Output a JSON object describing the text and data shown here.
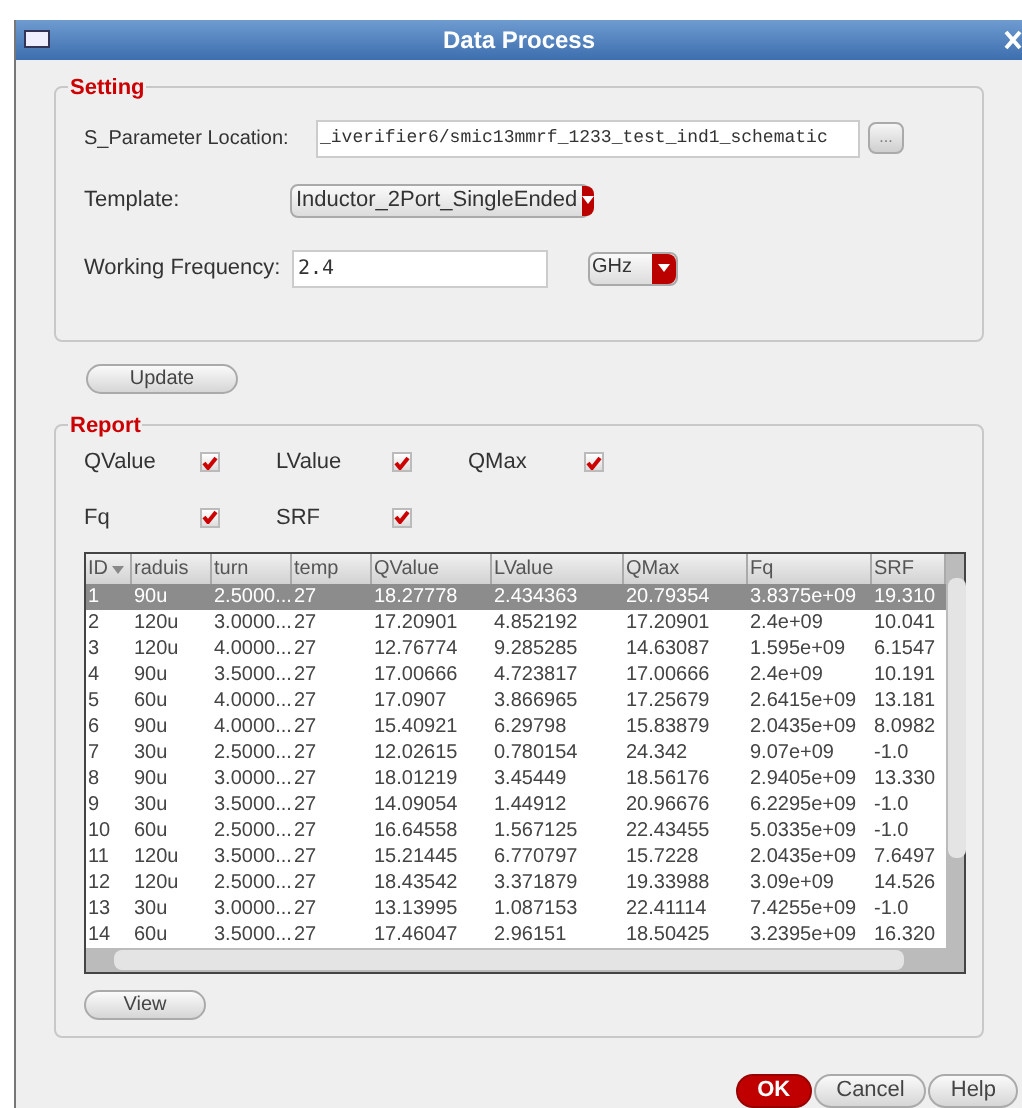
{
  "window": {
    "title": "Data Process"
  },
  "setting": {
    "title": "Setting",
    "location": {
      "label": "S_Parameter Location:",
      "value": "_iverifier6/smic13mmrf_1233_test_ind1_schematic",
      "browse": "..."
    },
    "template": {
      "label": "Template:",
      "value": "Inductor_2Port_SingleEnded"
    },
    "frequency": {
      "label": "Working Frequency:",
      "value": "2.4",
      "unit": "GHz"
    }
  },
  "update_button": "Update",
  "report": {
    "title": "Report",
    "options": [
      {
        "label": "QValue",
        "checked": true
      },
      {
        "label": "LValue",
        "checked": true
      },
      {
        "label": "QMax",
        "checked": true
      },
      {
        "label": "Fq",
        "checked": true
      },
      {
        "label": "SRF",
        "checked": true
      }
    ],
    "table": {
      "columns": [
        "ID",
        "raduis",
        "turn",
        "temp",
        "QValue",
        "LValue",
        "QMax",
        "Fq",
        "SRF"
      ],
      "rows": [
        {
          "selected": true,
          "cells": [
            "1",
            "90u",
            "2.5000...",
            "27",
            "18.27778",
            "2.434363",
            "20.79354",
            "3.8375e+09",
            "19.310"
          ]
        },
        {
          "selected": false,
          "cells": [
            "2",
            "120u",
            "3.0000...",
            "27",
            "17.20901",
            "4.852192",
            "17.20901",
            "2.4e+09",
            "10.041"
          ]
        },
        {
          "selected": false,
          "cells": [
            "3",
            "120u",
            "4.0000...",
            "27",
            "12.76774",
            "9.285285",
            "14.63087",
            "1.595e+09",
            "6.1547"
          ]
        },
        {
          "selected": false,
          "cells": [
            "4",
            "90u",
            "3.5000...",
            "27",
            "17.00666",
            "4.723817",
            "17.00666",
            "2.4e+09",
            "10.191"
          ]
        },
        {
          "selected": false,
          "cells": [
            "5",
            "60u",
            "4.0000...",
            "27",
            "17.0907",
            "3.866965",
            "17.25679",
            "2.6415e+09",
            "13.181"
          ]
        },
        {
          "selected": false,
          "cells": [
            "6",
            "90u",
            "4.0000...",
            "27",
            "15.40921",
            "6.29798",
            "15.83879",
            "2.0435e+09",
            "8.0982"
          ]
        },
        {
          "selected": false,
          "cells": [
            "7",
            "30u",
            "2.5000...",
            "27",
            "12.02615",
            "0.780154",
            "24.342",
            "9.07e+09",
            "-1.0"
          ]
        },
        {
          "selected": false,
          "cells": [
            "8",
            "90u",
            "3.0000...",
            "27",
            "18.01219",
            "3.45449",
            "18.56176",
            "2.9405e+09",
            "13.330"
          ]
        },
        {
          "selected": false,
          "cells": [
            "9",
            "30u",
            "3.5000...",
            "27",
            "14.09054",
            "1.44912",
            "20.96676",
            "6.2295e+09",
            "-1.0"
          ]
        },
        {
          "selected": false,
          "cells": [
            "10",
            "60u",
            "2.5000...",
            "27",
            "16.64558",
            "1.567125",
            "22.43455",
            "5.0335e+09",
            "-1.0"
          ]
        },
        {
          "selected": false,
          "cells": [
            "11",
            "120u",
            "3.5000...",
            "27",
            "15.21445",
            "6.770797",
            "15.7228",
            "2.0435e+09",
            "7.6497"
          ]
        },
        {
          "selected": false,
          "cells": [
            "12",
            "120u",
            "2.5000...",
            "27",
            "18.43542",
            "3.371879",
            "19.33988",
            "3.09e+09",
            "14.526"
          ]
        },
        {
          "selected": false,
          "cells": [
            "13",
            "30u",
            "3.0000...",
            "27",
            "13.13995",
            "1.087153",
            "22.41114",
            "7.4255e+09",
            "-1.0"
          ]
        },
        {
          "selected": false,
          "cells": [
            "14",
            "60u",
            "3.5000...",
            "27",
            "17.46047",
            "2.96151",
            "18.50425",
            "3.2395e+09",
            "16.320"
          ]
        }
      ]
    },
    "view_button": "View"
  },
  "buttons": [
    {
      "label": "OK",
      "kind": "primary"
    },
    {
      "label": "Cancel",
      "kind": "normal"
    },
    {
      "label": "Help",
      "kind": "normal"
    }
  ]
}
